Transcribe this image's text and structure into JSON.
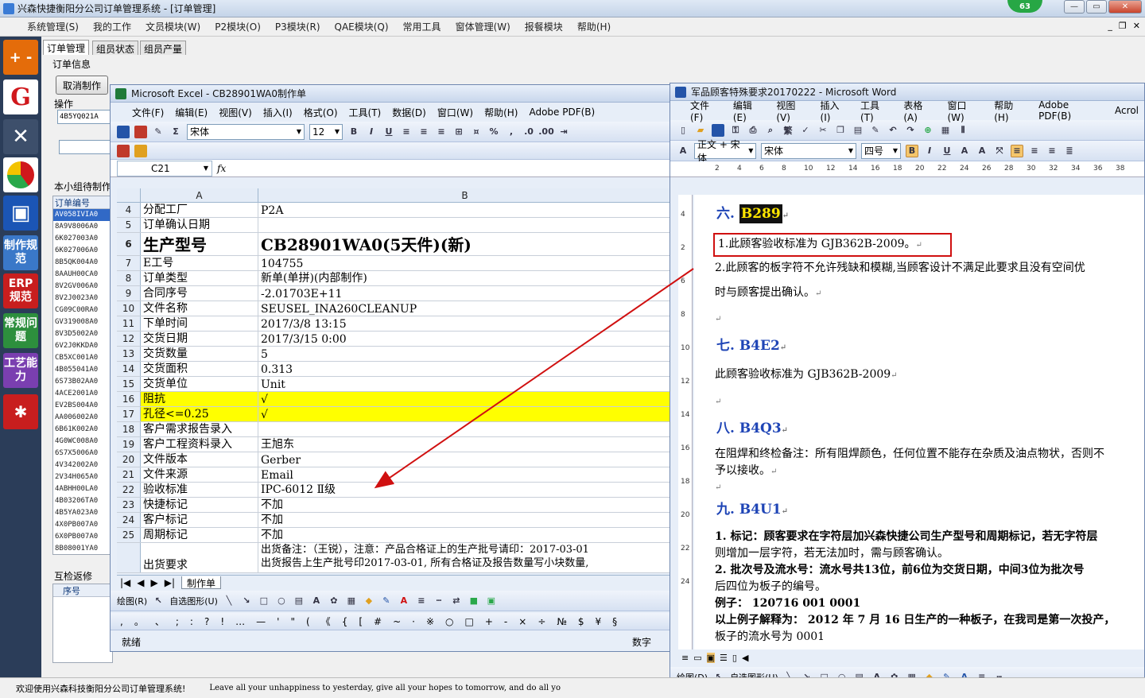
{
  "app": {
    "title": "兴森快捷衡阳分公司订单管理系统 - [订单管理]",
    "badge": "63",
    "menu": [
      "系统管理(S)",
      "我的工作",
      "文员模块(W)",
      "P2模块(O)",
      "P3模块(R)",
      "QAE模块(Q)",
      "常用工具",
      "窗体管理(W)",
      "报餐模块",
      "帮助(H)"
    ],
    "tabs": [
      "订单管理",
      "组员状态",
      "组员产量"
    ],
    "order_info_label": "订单信息",
    "cancel_button": "取消制作",
    "operation_label": "操作",
    "operation_value": "4B5YQ021A",
    "group_label": "本小组待制作",
    "order_list_header": "订单编号",
    "order_list": [
      "AV058IVIA0",
      "8A9V8006A0",
      "6K027003A0",
      "6K027006A0",
      "8B5QK004A0",
      "8AAUH00CA0",
      "8V2GV006A0",
      "8V2J0023A0",
      "CG09C00RA0",
      "GV319008A0",
      "8V3D5002A0",
      "6V2J0KKDA0",
      "CB5XC001A0",
      "4B055041A0",
      "6S73B02AA0",
      "4ACE2001A0",
      "EV2BS004A0",
      "AA006002A0",
      "6B61K002A0",
      "4G0WC008A0",
      "6S7X5006A0",
      "4V342002A0",
      "2V34H065A0",
      "4ABHH00LA0",
      "4B03206TA0",
      "4B5YA023A0",
      "4X0PB007A0",
      "6X0PB007A0",
      "8B08001YA0"
    ],
    "recheck_label": "互检返修",
    "recheck_col": "序号",
    "sidebar": [
      "ERP规范",
      "制作规范",
      "常规问题",
      "工艺能力"
    ],
    "status_welcome": "欢迎使用兴森科技衡阳分公司订单管理系统!",
    "status_quote": "Leave all your unhappiness to yesterday, give all your hopes to tomorrow, and do all yo"
  },
  "excel": {
    "title": "Microsoft Excel - CB28901WA0制作单",
    "menu": [
      "文件(F)",
      "编辑(E)",
      "视图(V)",
      "插入(I)",
      "格式(O)",
      "工具(T)",
      "数据(D)",
      "窗口(W)",
      "帮助(H)",
      "Adobe PDF(B)"
    ],
    "font_name": "宋体",
    "font_size": "12",
    "name_box": "C21",
    "fx": "fx",
    "col_a": "A",
    "col_b": "B",
    "rows": [
      {
        "n": "4",
        "a": "分配工厂",
        "b": "P2A"
      },
      {
        "n": "5",
        "a": "订单确认日期",
        "b": ""
      },
      {
        "n": "6",
        "a": "生产型号",
        "b": "CB28901WA0(5天件)(新)"
      },
      {
        "n": "7",
        "a": "E工号",
        "b": "104755"
      },
      {
        "n": "8",
        "a": "订单类型",
        "b": "新单(单拼)(内部制作)"
      },
      {
        "n": "9",
        "a": "合同序号",
        "b": "-2.01703E+11"
      },
      {
        "n": "10",
        "a": "文件名称",
        "b": "SEUSEL_INA260CLEANUP"
      },
      {
        "n": "11",
        "a": "下单时间",
        "b": "2017/3/8 13:15"
      },
      {
        "n": "12",
        "a": "交货日期",
        "b": "2017/3/15 0:00"
      },
      {
        "n": "13",
        "a": "交货数量",
        "b": "5"
      },
      {
        "n": "14",
        "a": "交货面积",
        "b": "0.313"
      },
      {
        "n": "15",
        "a": "交货单位",
        "b": "Unit"
      },
      {
        "n": "16",
        "a": "阻抗",
        "b": "√"
      },
      {
        "n": "17",
        "a": "孔径<=0.25",
        "b": "√"
      },
      {
        "n": "18",
        "a": "客户需求报告录入",
        "b": ""
      },
      {
        "n": "19",
        "a": "客户工程资料录入",
        "b": "王旭东"
      },
      {
        "n": "20",
        "a": "文件版本",
        "b": "Gerber"
      },
      {
        "n": "21",
        "a": "文件来源",
        "b": "Email"
      },
      {
        "n": "22",
        "a": "验收标准",
        "b": "IPC-6012 Ⅱ级"
      },
      {
        "n": "23",
        "a": "快捷标记",
        "b": "不加"
      },
      {
        "n": "24",
        "a": "客户标记",
        "b": "不加"
      },
      {
        "n": "25",
        "a": "周期标记",
        "b": "不加"
      }
    ],
    "row26": {
      "a": "出货要求",
      "b1": "出货备注：（王锐），注意：产品合格证上的生产批号请印：2017-03-01",
      "b2": "出货报告上生产批号印2017-03-01, 所有合格证及报告数量写小块数量,"
    },
    "sheet_tab": "制作单",
    "draw_label": "绘图(R)",
    "autoshape_label": "自选图形(U)",
    "symbols": [
      ",",
      "。",
      "、",
      ";",
      ":",
      "?",
      "!",
      "…",
      "—",
      "'",
      "\"",
      "(",
      "《",
      "{",
      "[",
      "#",
      "~",
      "·",
      "※",
      "○",
      "□",
      "+",
      "-",
      "×",
      "÷",
      "№",
      "$",
      "¥",
      "§"
    ],
    "status_ready": "就绪",
    "status_num": "数字"
  },
  "word": {
    "title": "军品顾客特殊要求20170222 - Microsoft Word",
    "menu": [
      "文件(F)",
      "编辑(E)",
      "视图(V)",
      "插入(I)",
      "工具(T)",
      "表格(A)",
      "窗口(W)",
      "帮助(H)",
      "Adobe PDF(B)",
      "Acrol"
    ],
    "style": "正文 + 宋体",
    "font": "宋体",
    "size": "四号",
    "ruler_h": [
      "2",
      "4",
      "6",
      "8",
      "10",
      "12",
      "14",
      "16",
      "18",
      "20",
      "22",
      "24",
      "26",
      "28",
      "30",
      "32",
      "34",
      "36",
      "38"
    ],
    "ruler_v": [
      "4",
      "2",
      "6",
      "8",
      "10",
      "12",
      "14",
      "16",
      "18",
      "20",
      "22",
      "24"
    ],
    "s6_head": "六.",
    "s6_code": "B289",
    "s6_p1": "1.此顾客验收标准为 GJB362B-2009。",
    "s6_p2a": "2.此顾客的板字符不允许残缺和模糊,当顾客设计不满足此要求且没有空间优",
    "s6_p2b": "时与顾客提出确认。",
    "s7_head": "七. B4E2",
    "s7_p": "此顾客验收标准为 GJB362B-2009",
    "s8_head": "八. B4Q3",
    "s8_p1": "在阻焊和终检备注：所有阻焊颜色，任何位置不能存在杂质及油点物状，否则不",
    "s8_p2": "予以接收。",
    "s9_head": "九. B4U1",
    "s9_l1": "1. 标记：顾客要求在字符层加兴森快捷公司生产型号和周期标记，若无字符层",
    "s9_l2": "则增加一层字符，若无法加时，需与顾客确认。",
    "s9_l3": "2. 批次号及流水号：流水号共13位，前6位为交货日期，中间3位为批次号",
    "s9_l4": "后四位为板子的编号。",
    "s9_l5": "例子：  120716 001 0001",
    "s9_l6": "以上例子解释为：  2012 年 7 月 16 日生产的一种板子，在我司是第一次投产，",
    "s9_l7": "板子的流水号为 0001",
    "para_mark": "↵",
    "draw_label": "绘图(D)",
    "autoshape_label": "自选图形(U)"
  },
  "colors": {
    "accent": "#d01010",
    "heading": "#1f45b6",
    "highlight": "#ffff00"
  }
}
